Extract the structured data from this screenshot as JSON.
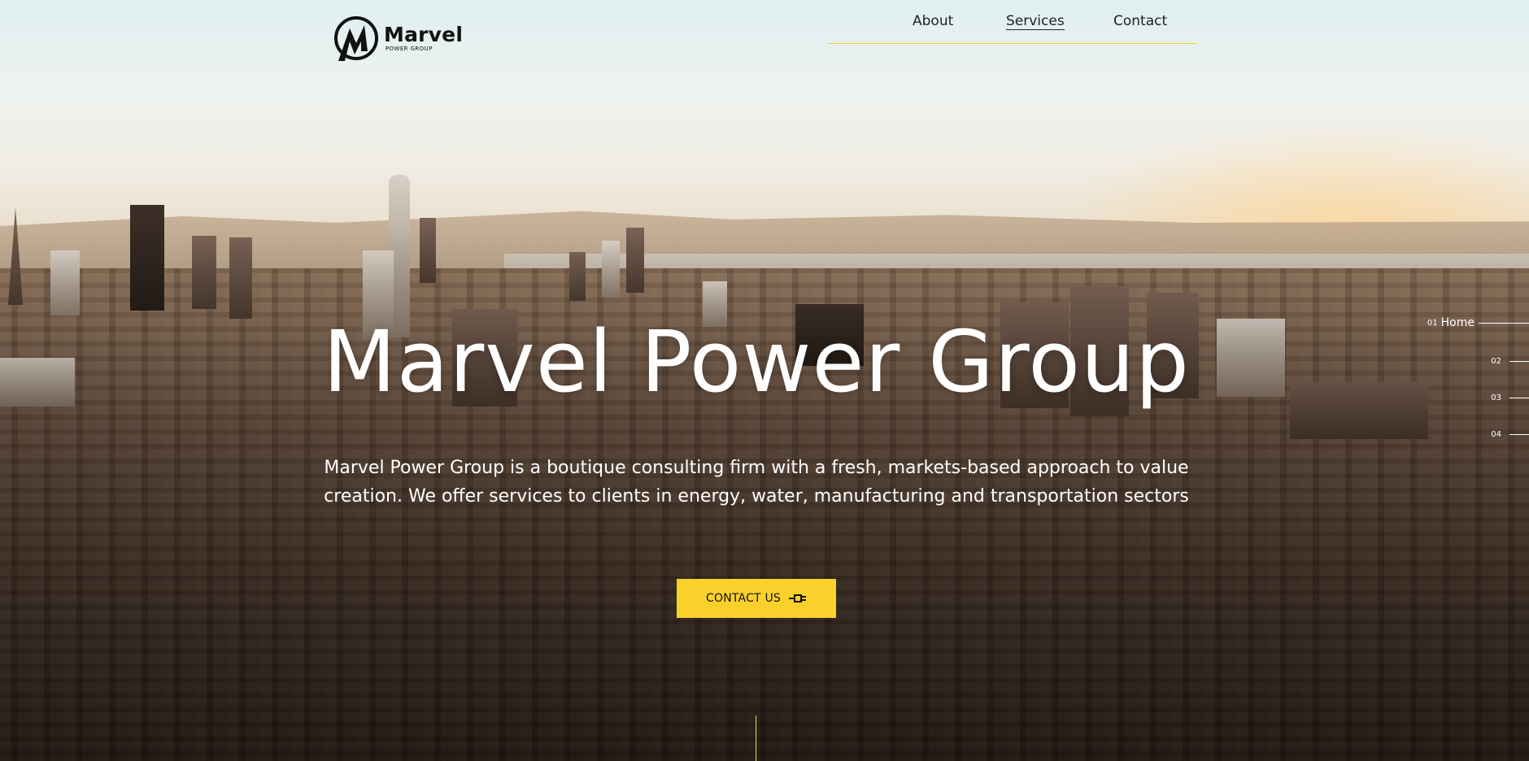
{
  "brand": {
    "name": "Marvel",
    "tagline": "POWER GROUP"
  },
  "nav": {
    "items": [
      {
        "label": "About"
      },
      {
        "label": "Services"
      },
      {
        "label": "Contact"
      }
    ],
    "active": "Services"
  },
  "hero": {
    "title": "Marvel Power Group",
    "description_line1": "Marvel Power Group is a boutique consulting firm with a fresh, markets-based approach to value",
    "description_line2": "creation. We offer services to clients in energy, water, manufacturing and transportation sectors",
    "cta_label": "CONTACT US"
  },
  "pager": {
    "items": [
      {
        "num": "01",
        "label": "Home"
      },
      {
        "num": "02",
        "label": ""
      },
      {
        "num": "03",
        "label": ""
      },
      {
        "num": "04",
        "label": ""
      }
    ]
  },
  "colors": {
    "accent": "#f9d12a",
    "text_dark": "#111111",
    "text_light": "#ffffff"
  },
  "icons": {
    "logo": "marvel-m-logo-icon",
    "cta": "plug-icon"
  }
}
